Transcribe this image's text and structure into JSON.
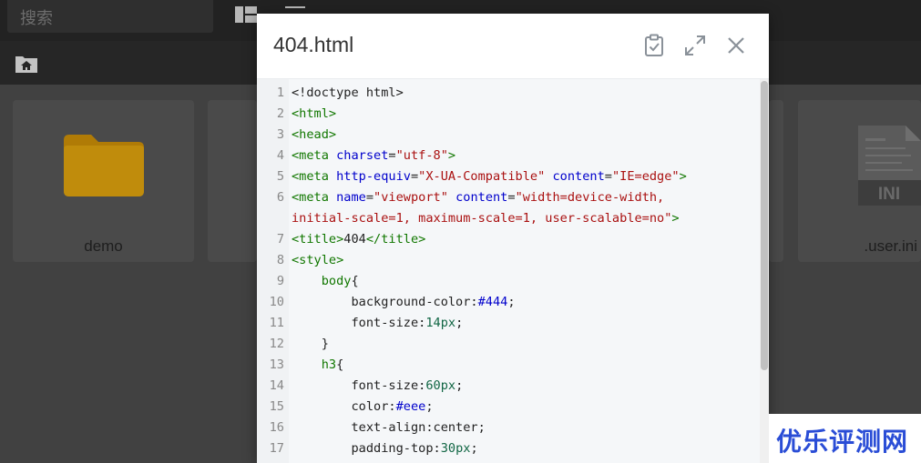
{
  "background": {
    "search": {
      "placeholder": "搜索"
    },
    "toolbar": {
      "grid_icon": "grid-view-icon",
      "menu_icon": "menu-icon",
      "home_icon": "home-folder-icon"
    },
    "files": [
      {
        "name": "demo",
        "icon": "folder-icon"
      },
      {
        "name": ".user.ini",
        "icon": "ini-file-icon",
        "badge": "INI"
      }
    ]
  },
  "modal": {
    "title": "404.html",
    "actions": {
      "check_icon": "clipboard-check-icon",
      "expand_icon": "expand-icon",
      "close_icon": "close-icon"
    },
    "code_lines": [
      {
        "n": "1",
        "t": [
          [
            "p",
            "<!doctype html>"
          ]
        ]
      },
      {
        "n": "2",
        "t": [
          [
            "tag",
            "<html>"
          ]
        ]
      },
      {
        "n": "3",
        "t": [
          [
            "tag",
            "<head>"
          ]
        ]
      },
      {
        "n": "4",
        "t": [
          [
            "tag",
            "<meta "
          ],
          [
            "attr",
            "charset"
          ],
          [
            "p",
            "="
          ],
          [
            "str",
            "\"utf-8\""
          ],
          [
            "tag",
            ">"
          ]
        ]
      },
      {
        "n": "5",
        "t": [
          [
            "tag",
            "<meta "
          ],
          [
            "attr",
            "http-equiv"
          ],
          [
            "p",
            "="
          ],
          [
            "str",
            "\"X-UA-Compatible\""
          ],
          [
            "p",
            " "
          ],
          [
            "attr",
            "content"
          ],
          [
            "p",
            "="
          ],
          [
            "str",
            "\"IE=edge\""
          ],
          [
            "tag",
            ">"
          ]
        ]
      },
      {
        "n": "6",
        "tall": true,
        "t": [
          [
            "tag",
            "<meta "
          ],
          [
            "attr",
            "name"
          ],
          [
            "p",
            "="
          ],
          [
            "str",
            "\"viewport\""
          ],
          [
            "p",
            " "
          ],
          [
            "attr",
            "content"
          ],
          [
            "p",
            "="
          ],
          [
            "str",
            "\"width=device-width,\ninitial-scale=1, maximum-scale=1, user-scalable=no\""
          ],
          [
            "tag",
            ">"
          ]
        ]
      },
      {
        "n": "7",
        "t": [
          [
            "tag",
            "<title>"
          ],
          [
            "p",
            "404"
          ],
          [
            "tag",
            "</title>"
          ]
        ]
      },
      {
        "n": "8",
        "t": [
          [
            "tag",
            "<style>"
          ]
        ]
      },
      {
        "n": "9",
        "t": [
          [
            "p",
            "    "
          ],
          [
            "tag",
            "body"
          ],
          [
            "p",
            "{"
          ]
        ]
      },
      {
        "n": "10",
        "t": [
          [
            "p",
            "        background-color:"
          ],
          [
            "color",
            "#444"
          ],
          [
            "p",
            ";"
          ]
        ]
      },
      {
        "n": "11",
        "t": [
          [
            "p",
            "        font-size:"
          ],
          [
            "num",
            "14px"
          ],
          [
            "p",
            ";"
          ]
        ]
      },
      {
        "n": "12",
        "t": [
          [
            "p",
            "    }"
          ]
        ]
      },
      {
        "n": "13",
        "t": [
          [
            "p",
            "    "
          ],
          [
            "tag",
            "h3"
          ],
          [
            "p",
            "{"
          ]
        ]
      },
      {
        "n": "14",
        "t": [
          [
            "p",
            "        font-size:"
          ],
          [
            "num",
            "60px"
          ],
          [
            "p",
            ";"
          ]
        ]
      },
      {
        "n": "15",
        "t": [
          [
            "p",
            "        color:"
          ],
          [
            "color",
            "#eee"
          ],
          [
            "p",
            ";"
          ]
        ]
      },
      {
        "n": "16",
        "t": [
          [
            "p",
            "        text-align:center;"
          ]
        ]
      },
      {
        "n": "17",
        "t": [
          [
            "p",
            "        padding-top:"
          ],
          [
            "num",
            "30px"
          ],
          [
            "p",
            ";"
          ]
        ]
      }
    ]
  },
  "watermark": {
    "text": "优乐评测网"
  },
  "colors": {
    "tag": "#117700",
    "attr": "#0000cc",
    "string": "#aa1111",
    "number": "#116644",
    "watermark": "#2a4dd6"
  }
}
